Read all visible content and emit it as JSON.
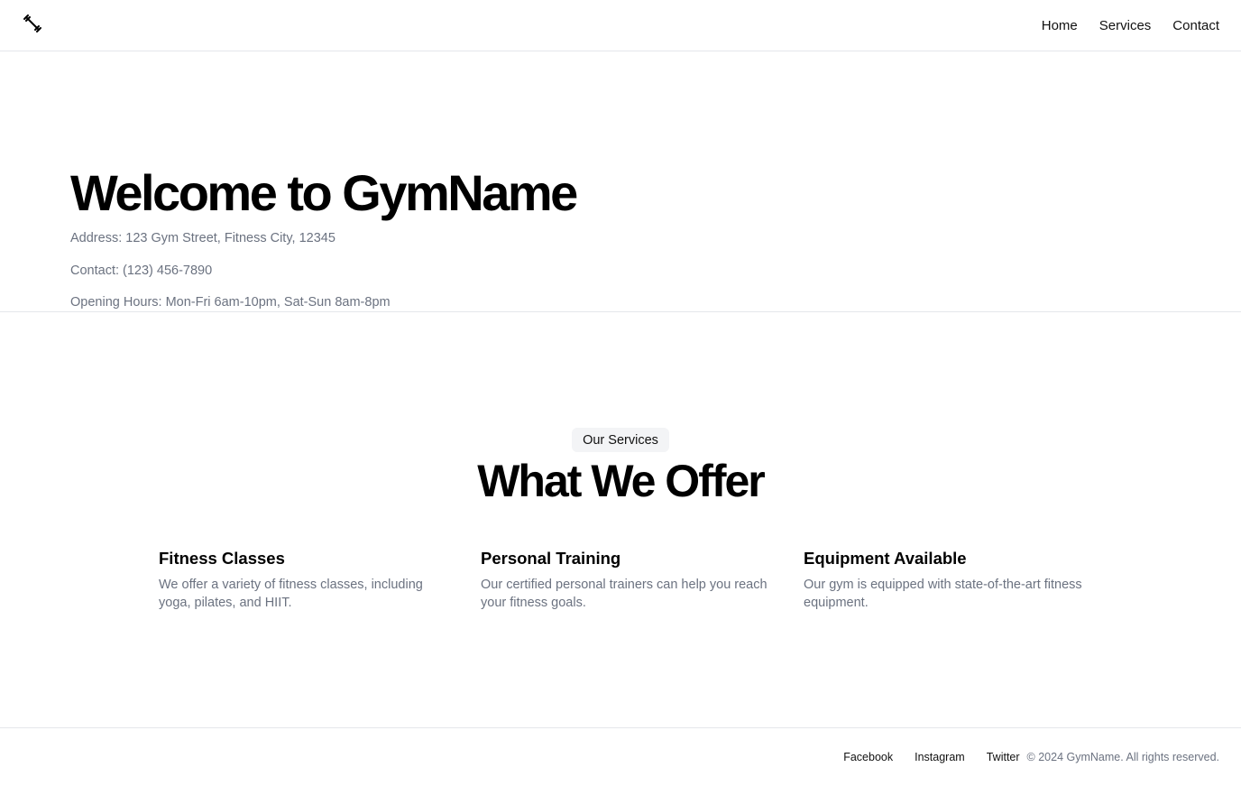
{
  "nav": {
    "links": [
      "Home",
      "Services",
      "Contact"
    ]
  },
  "hero": {
    "title": "Welcome to GymName",
    "address": "Address: 123 Gym Street, Fitness City, 12345",
    "contact": "Contact: (123) 456-7890",
    "hours": "Opening Hours: Mon-Fri 6am-10pm, Sat-Sun 8am-8pm"
  },
  "services": {
    "badge": "Our Services",
    "title": "What We Offer",
    "items": [
      {
        "title": "Fitness Classes",
        "desc": "We offer a variety of fitness classes, including yoga, pilates, and HIIT."
      },
      {
        "title": "Personal Training",
        "desc": "Our certified personal trainers can help you reach your fitness goals."
      },
      {
        "title": "Equipment Available",
        "desc": "Our gym is equipped with state-of-the-art fitness equipment."
      }
    ]
  },
  "footer": {
    "links": [
      "Facebook",
      "Instagram",
      "Twitter"
    ],
    "copyright": "© 2024 GymName. All rights reserved."
  }
}
